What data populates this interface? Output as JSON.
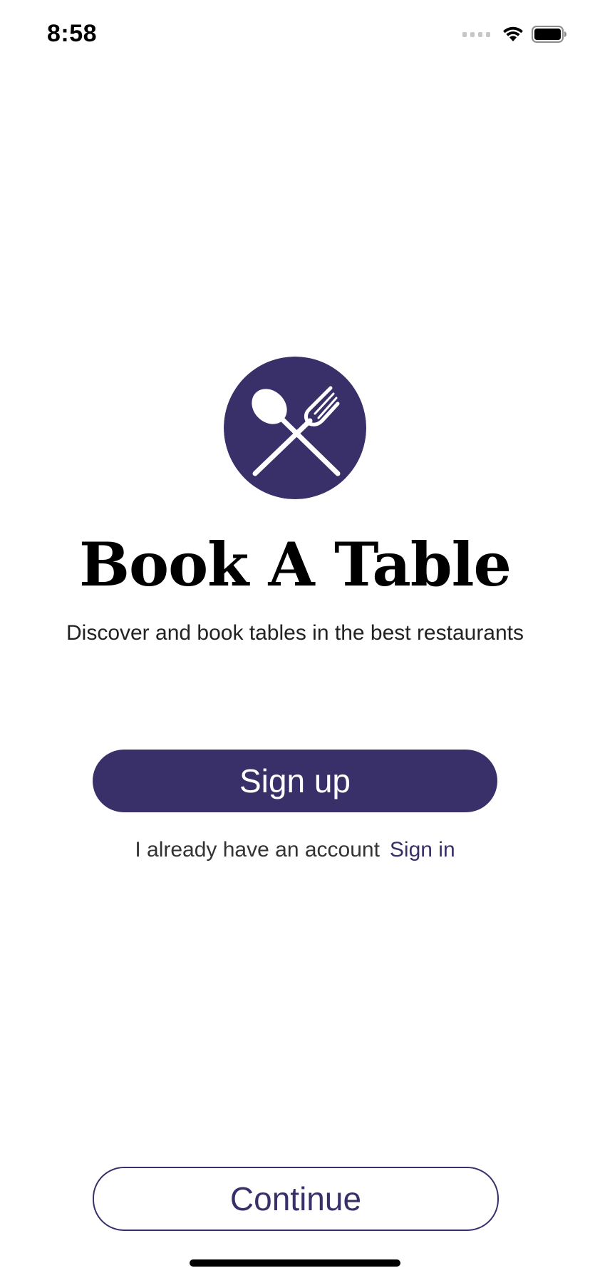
{
  "status_bar": {
    "time": "8:58",
    "icons": [
      "cellular-signal-icon",
      "wifi-icon",
      "battery-icon"
    ]
  },
  "logo": {
    "icon": "crossed-spoon-fork-icon",
    "color": "#39306a"
  },
  "title": "Book A Table",
  "subtitle": "Discover and book tables in the best restaurants",
  "signup_button": {
    "label": "Sign up"
  },
  "account_row": {
    "text": "I already have an account",
    "signin_label": "Sign in"
  },
  "continue_button": {
    "label": "Continue"
  },
  "colors": {
    "accent": "#39306a",
    "background": "#ffffff",
    "text": "#000000"
  }
}
